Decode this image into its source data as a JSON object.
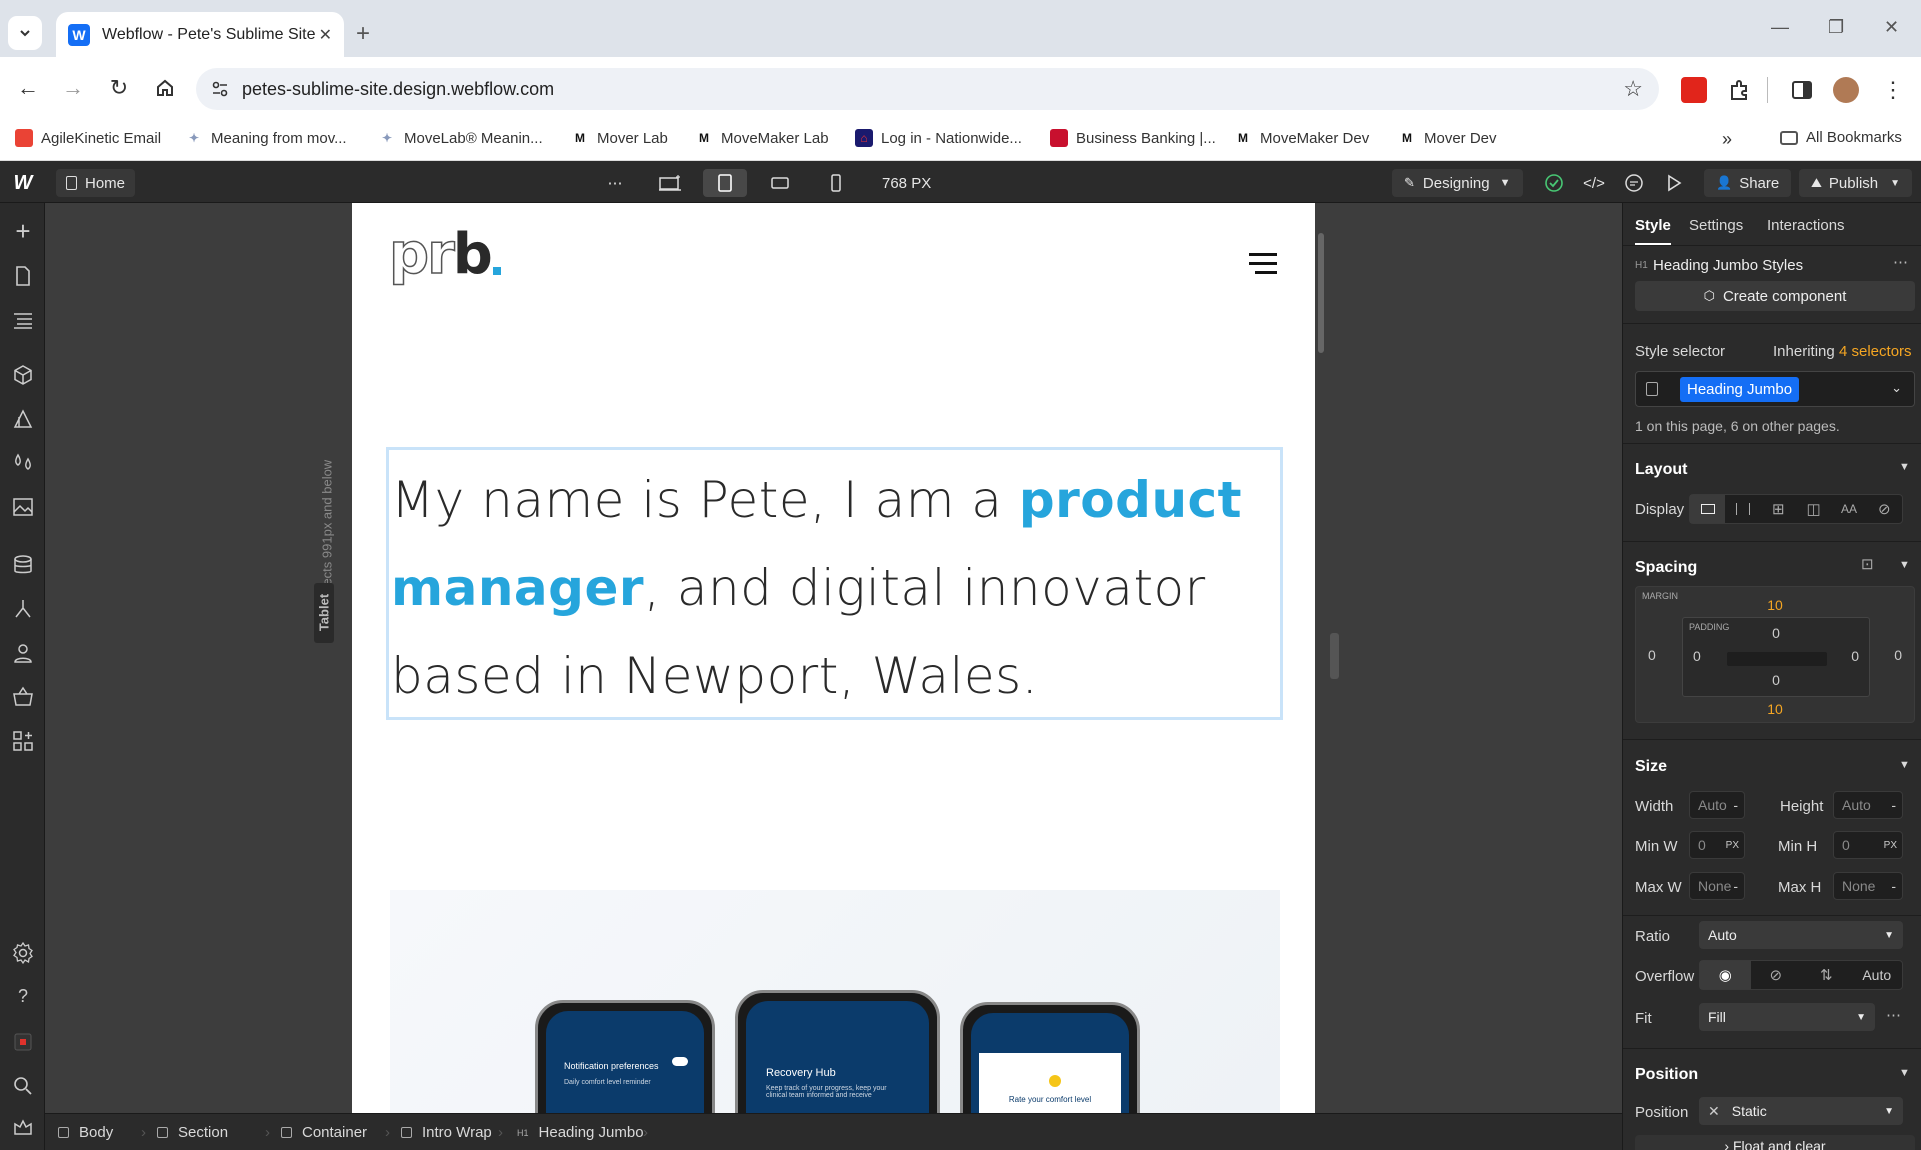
{
  "browser": {
    "tab_title": "Webflow - Pete's Sublime Site",
    "url": "petes-sublime-site.design.webflow.com",
    "bookmarks": [
      {
        "label": "AgileKinetic Email",
        "icon": "red-squares-icon"
      },
      {
        "label": "Meaning from mov...",
        "icon": "movelab-icon"
      },
      {
        "label": "MoveLab® Meanin...",
        "icon": "movelab-icon"
      },
      {
        "label": "Mover Lab",
        "icon": "m-icon"
      },
      {
        "label": "MoveMaker Lab",
        "icon": "m-icon"
      },
      {
        "label": "Log in - Nationwide...",
        "icon": "nationwide-icon"
      },
      {
        "label": "Business Banking |...",
        "icon": "bank-icon"
      },
      {
        "label": "MoveMaker Dev",
        "icon": "m-icon"
      },
      {
        "label": "Mover Dev",
        "icon": "m-icon"
      }
    ],
    "all_bookmarks": "All Bookmarks"
  },
  "webflow_top": {
    "page": "Home",
    "breakpoint_width": "768 PX",
    "mode": "Designing",
    "share": "Share",
    "publish": "Publish"
  },
  "canvas": {
    "breakpoint_note": "Affects 991px and below",
    "breakpoint_tag": "Tablet",
    "logo_text": "prb",
    "heading_pre": "My name is Pete, I am a ",
    "heading_highlight": "product manager",
    "heading_post": ", and digital innovator based in Newport, Wales.",
    "phone_middle_title": "Recovery Hub",
    "phone_middle_text": "Keep track of your progress, keep your clinical team informed and receive",
    "phone_left_title": "Notification preferences",
    "phone_left_text": "Daily comfort level reminder",
    "phone_right_text": "Rate your comfort level",
    "accent_color": "#26a5dc"
  },
  "style_panel": {
    "tabs": [
      "Style",
      "Settings",
      "Interactions"
    ],
    "element_tag": "H1",
    "element_title": "Heading Jumbo Styles",
    "create_component": "Create component",
    "style_selector_label": "Style selector",
    "inheriting": "Inheriting",
    "selectors_count": "4 selectors",
    "selector_chip": "Heading Jumbo",
    "usage": "1 on this page, 6 on other pages.",
    "layout": "Layout",
    "display": "Display",
    "spacing": "Spacing",
    "margin_label": "MARGIN",
    "padding_label": "PADDING",
    "margin_top": "10",
    "margin_bottom": "10",
    "margin_left": "0",
    "margin_right": "0",
    "padding_top": "0",
    "padding_bottom": "0",
    "padding_left": "0",
    "padding_right": "0",
    "size": "Size",
    "width_label": "Width",
    "width_value": "Auto",
    "height_label": "Height",
    "height_value": "Auto",
    "minw_label": "Min W",
    "minw_value": "0",
    "minh_label": "Min H",
    "minh_value": "0",
    "unit_px": "PX",
    "maxw_label": "Max W",
    "maxw_value": "None",
    "maxh_label": "Max H",
    "maxh_value": "None",
    "dash": "-",
    "ratio_label": "Ratio",
    "ratio_value": "Auto",
    "overflow_label": "Overflow",
    "overflow_auto": "Auto",
    "fit_label": "Fit",
    "fit_value": "Fill",
    "position_section": "Position",
    "position_label": "Position",
    "position_value": "Static",
    "float_clear": "Float and clear",
    "orange": "#f5a623",
    "blue_chip": "#146ef5"
  },
  "breadcrumbs": [
    "Body",
    "Section",
    "Container",
    "Intro Wrap",
    "Heading Jumbo"
  ],
  "breadcrumb_tag": "H1"
}
